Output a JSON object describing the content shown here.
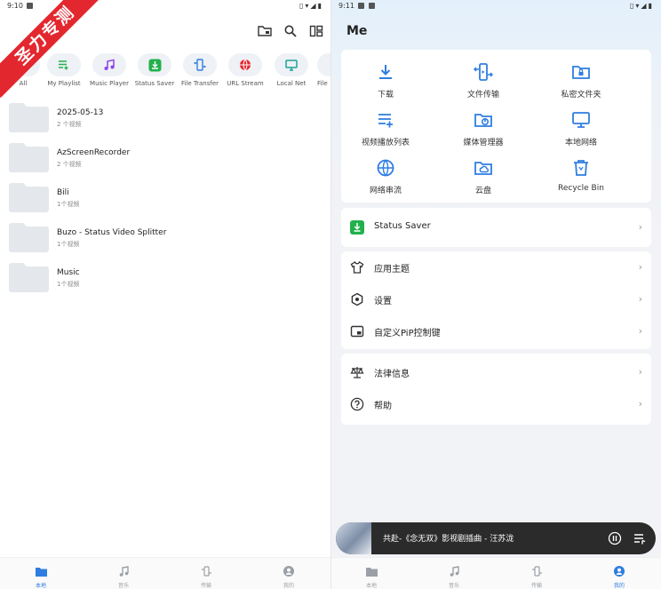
{
  "left_screen": {
    "status_time": "9:10",
    "shortcuts": [
      {
        "label": "All",
        "icon": "all-icon"
      },
      {
        "label": "My Playlist",
        "icon": "playlist-icon"
      },
      {
        "label": "Music Player",
        "icon": "music-note-icon"
      },
      {
        "label": "Status Saver",
        "icon": "status-saver-icon"
      },
      {
        "label": "File Transfer",
        "icon": "file-transfer-icon"
      },
      {
        "label": "URL Stream",
        "icon": "globe-icon"
      },
      {
        "label": "Local Net",
        "icon": "monitor-icon"
      },
      {
        "label": "File",
        "icon": "file-icon"
      }
    ],
    "folders": [
      {
        "name": "2025-05-13",
        "count": "2 个视频"
      },
      {
        "name": "AzScreenRecorder",
        "count": "2 个视频"
      },
      {
        "name": "Bili",
        "count": "1个视频"
      },
      {
        "name": "Buzo - Status Video Splitter",
        "count": "1个视频"
      },
      {
        "name": "Music",
        "count": "1个视频"
      }
    ],
    "watermark": "圣力专测",
    "nav": [
      "本地",
      "音乐",
      "传输",
      "我的"
    ]
  },
  "right_screen": {
    "status_time": "9:11",
    "title": "Me",
    "grid": [
      {
        "label": "下载",
        "icon": "download-icon"
      },
      {
        "label": "文件传输",
        "icon": "file-transfer-icon"
      },
      {
        "label": "私密文件夹",
        "icon": "private-folder-icon"
      },
      {
        "label": "视频播放列表",
        "icon": "playlist-icon"
      },
      {
        "label": "媒体管理器",
        "icon": "media-manager-icon"
      },
      {
        "label": "本地网络",
        "icon": "monitor-icon"
      },
      {
        "label": "网络串流",
        "icon": "globe-icon"
      },
      {
        "label": "云盘",
        "icon": "cloud-folder-icon"
      },
      {
        "label": "Recycle Bin",
        "icon": "trash-icon"
      }
    ],
    "status_saver": "Status Saver",
    "settings_rows": [
      {
        "label": "应用主题",
        "icon": "shirt-icon"
      },
      {
        "label": "设置",
        "icon": "gear-icon"
      },
      {
        "label": "自定义PiP控制键",
        "icon": "pip-icon"
      }
    ],
    "info_rows": [
      {
        "label": "法律信息",
        "icon": "scale-icon"
      },
      {
        "label": "帮助",
        "icon": "help-icon"
      }
    ],
    "now_playing": "共赴-《念无双》影视剧插曲 - 汪苏泷",
    "nav": [
      "本地",
      "音乐",
      "传输",
      "我的"
    ]
  },
  "colors": {
    "accent": "#2f7de1",
    "green": "#22b14c",
    "purple": "#8e44ec",
    "red": "#e3272f",
    "teal": "#1aa39a",
    "folder": "#e4e7eb"
  }
}
